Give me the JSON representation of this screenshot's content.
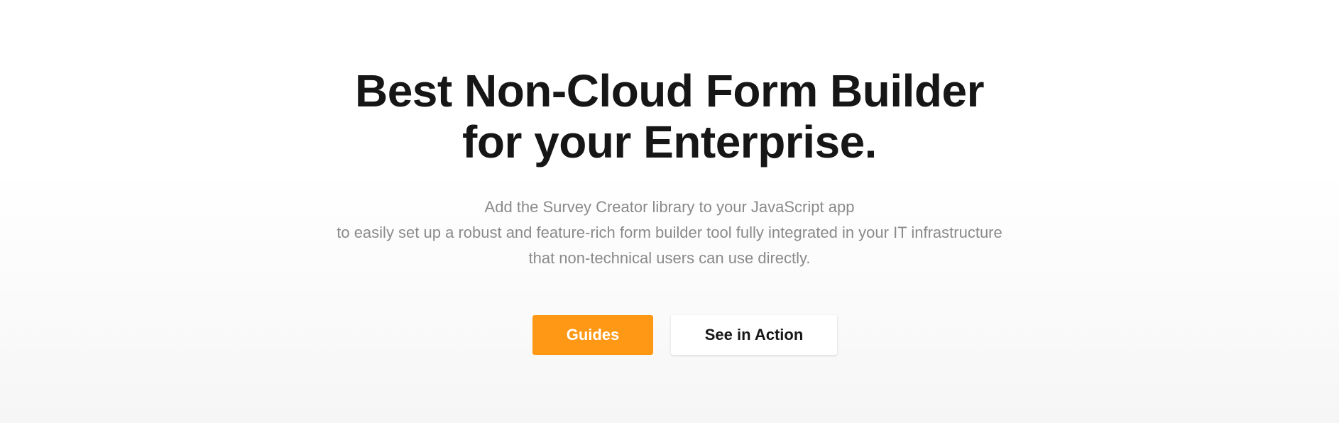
{
  "hero": {
    "headline_line1": "Best Non-Cloud Form Builder",
    "headline_line2": "for your Enterprise.",
    "subtext_line1": "Add the Survey Creator library to your JavaScript app",
    "subtext_line2": "to easily set up a robust and feature-rich form builder tool fully integrated in your IT infrastructure",
    "subtext_line3": "that non-technical users can use directly."
  },
  "actions": {
    "guides_label": "Guides",
    "see_in_action_label": "See in Action"
  },
  "colors": {
    "accent": "#ff9814",
    "headline": "#161616",
    "subtext": "#8a8a8a"
  }
}
